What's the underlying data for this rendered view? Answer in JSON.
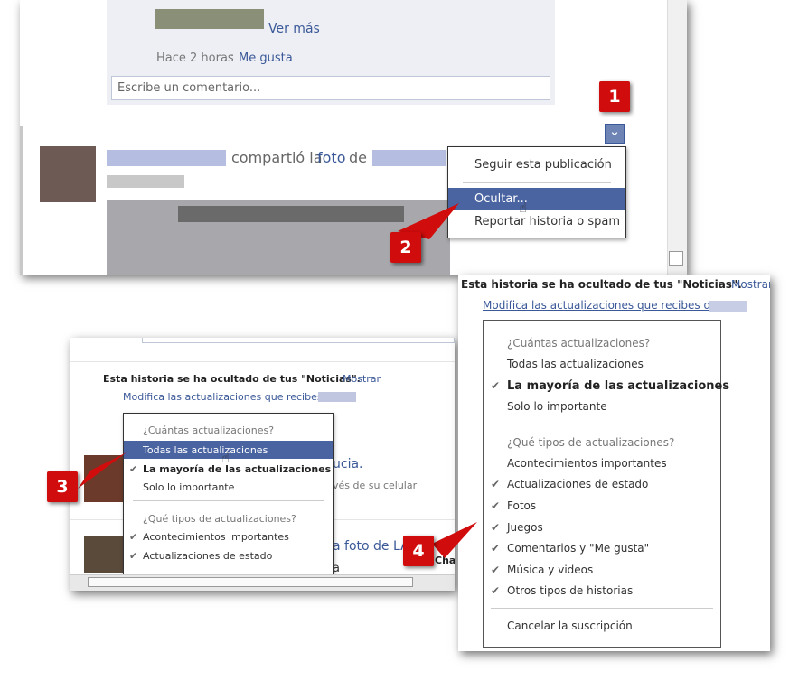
{
  "shot1": {
    "ver_mas": "Ver más",
    "timestamp": "Hace 2 horas",
    "dot": "·",
    "like": "Me gusta",
    "comment_placeholder": "Escribe un comentario...",
    "shared_text": "compartió la",
    "foto": "foto",
    "de": "de",
    "menu": {
      "follow": "Seguir esta publicación",
      "hide": "Ocultar...",
      "report": "Reportar historia o spam"
    }
  },
  "shot2": {
    "hidden_notice": "Esta historia se ha ocultado de tus \"Noticias\".",
    "show_link": "Mostrar",
    "modify_link": "Modifica las actualizaciones que recibes de",
    "menu": {
      "how_many_header": "¿Cuántas actualizaciones?",
      "all": "Todas las actualizaciones",
      "most": "La mayoría de las actualizaciones",
      "important": "Solo lo importante",
      "types_header": "¿Qué tipos de actualizaciones?",
      "events": "Acontecimientos importantes",
      "status": "Actualizaciones de estado"
    },
    "bg_text1": "ucia.",
    "bg_text2": "vés de su celular",
    "bg_text3": "a foto de LA",
    "bg_text4": "Chat",
    "bg_text5": "a"
  },
  "shot3": {
    "hidden_notice": "Esta historia se ha ocultado de tus \"Noticias\".",
    "show_link": "Mostrar",
    "modify_link": "Modifica las actualizaciones que recibes de",
    "menu": {
      "how_many_header": "¿Cuántas actualizaciones?",
      "all": "Todas las actualizaciones",
      "most": "La mayoría de las actualizaciones",
      "important": "Solo lo importante",
      "types_header": "¿Qué tipos de actualizaciones?",
      "events": "Acontecimientos importantes",
      "status": "Actualizaciones de estado",
      "photos": "Fotos",
      "games": "Juegos",
      "comments": "Comentarios y \"Me gusta\"",
      "music": "Música y videos",
      "other": "Otros tipos de historias",
      "unsubscribe": "Cancelar la suscripción"
    }
  },
  "badges": {
    "b1": "1",
    "b2": "2",
    "b3": "3",
    "b4": "4"
  },
  "icons": {
    "check": "✔",
    "chevron": "⌄",
    "cursor": "hand-pointer-icon"
  },
  "colors": {
    "fb_blue": "#3b5998",
    "highlight": "#4a64a2",
    "badge_red": "#d10c0c"
  }
}
